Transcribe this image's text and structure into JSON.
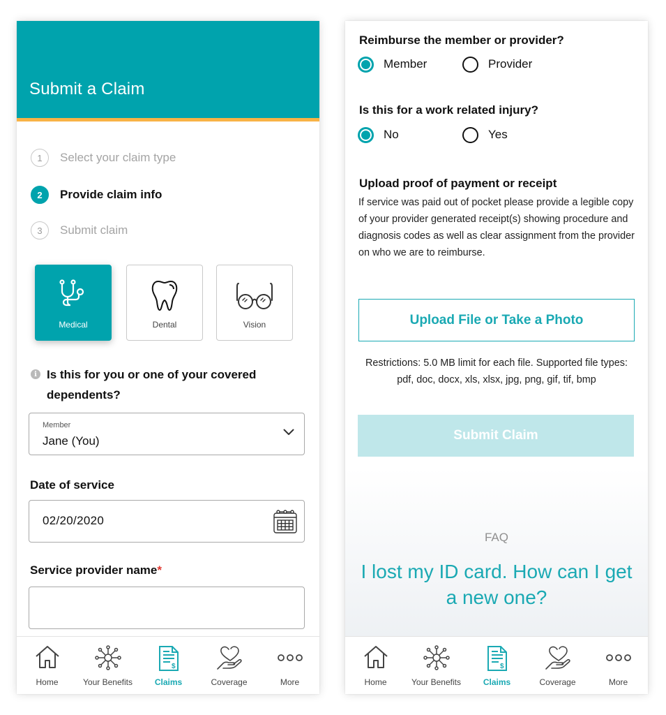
{
  "colors": {
    "brand_teal": "#00a3ad",
    "accent_orange": "#f8b346",
    "link_teal": "#1aa9b3",
    "disabled_button": "#bfe7ea",
    "required_red": "#e0372f"
  },
  "left_screen": {
    "header": {
      "title": "Submit a Claim"
    },
    "steps": [
      {
        "number": "1",
        "label": "Select your claim type",
        "state": "complete"
      },
      {
        "number": "2",
        "label": "Provide claim info",
        "state": "active"
      },
      {
        "number": "3",
        "label": "Submit claim",
        "state": "upcoming"
      }
    ],
    "claim_types": [
      {
        "label": "Medical",
        "icon": "stethoscope-icon",
        "selected": true
      },
      {
        "label": "Dental",
        "icon": "tooth-icon",
        "selected": false
      },
      {
        "label": "Vision",
        "icon": "glasses-icon",
        "selected": false
      }
    ],
    "dependent_question": "Is this for you or one of your covered dependents?",
    "member_select": {
      "caption": "Member",
      "value": "Jane (You)"
    },
    "date_of_service": {
      "label": "Date of service",
      "value": "02/20/2020"
    },
    "provider_name": {
      "label": "Service provider name",
      "required_mark": "*",
      "value": ""
    }
  },
  "right_screen": {
    "reimburse": {
      "question": "Reimburse the member or provider?",
      "options": [
        {
          "label": "Member",
          "checked": true
        },
        {
          "label": "Provider",
          "checked": false
        }
      ]
    },
    "work_injury": {
      "question": "Is this for a work related injury?",
      "options": [
        {
          "label": "No",
          "checked": true
        },
        {
          "label": "Yes",
          "checked": false
        }
      ]
    },
    "upload": {
      "title": "Upload proof of payment or receipt",
      "description": "If service was paid out of pocket please provide a legible copy of your provider generated receipt(s) showing procedure and diagnosis codes as well as clear assignment from the provider on who we are to reimburse.",
      "button_label": "Upload File or Take a Photo",
      "restrictions": "Restrictions: 5.0 MB limit for each file. Supported file types: pdf, doc, docx, xls, xlsx, jpg, png, gif, tif, bmp"
    },
    "submit_label": "Submit Claim",
    "faq": {
      "label": "FAQ",
      "question": "I lost my ID card. How can I get a new one?"
    }
  },
  "tabbar": {
    "items": [
      {
        "label": "Home",
        "icon": "home-icon",
        "active": false
      },
      {
        "label": "Your Benefits",
        "icon": "benefits-network-icon",
        "active": false
      },
      {
        "label": "Claims",
        "icon": "claim-document-icon",
        "active": true
      },
      {
        "label": "Coverage",
        "icon": "heart-hand-icon",
        "active": false
      },
      {
        "label": "More",
        "icon": "more-dots-icon",
        "active": false
      }
    ]
  }
}
